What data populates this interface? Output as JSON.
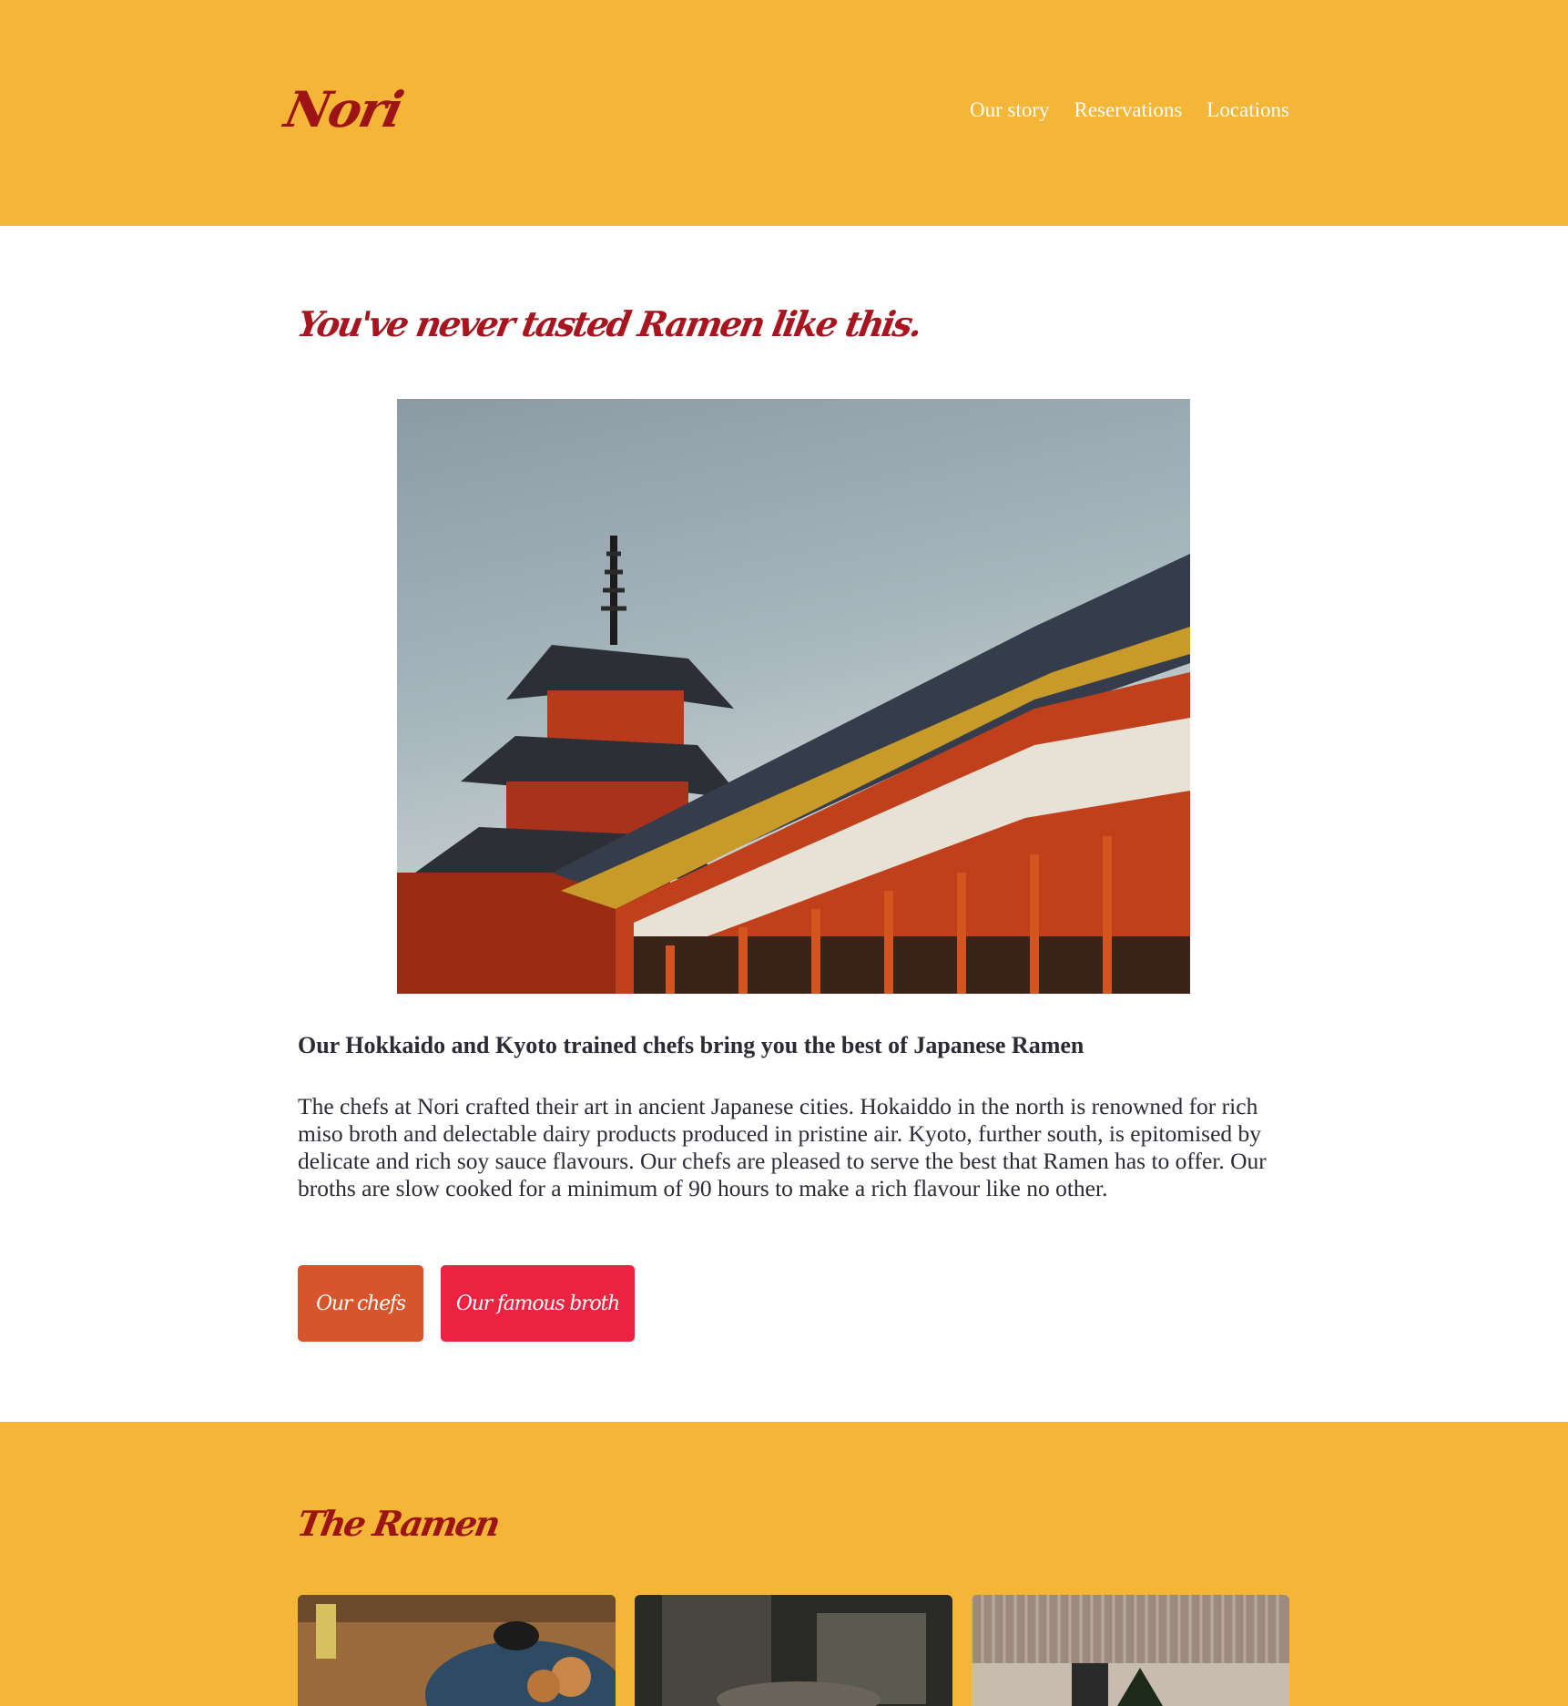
{
  "header": {
    "logo": "Nori",
    "nav": [
      "Our story",
      "Reservations",
      "Locations"
    ]
  },
  "hero": {
    "title": "You've never tasted Ramen like this.",
    "subhead": "Our Hokkaido and Kyoto trained chefs bring you the best of Japanese Ramen",
    "body": "The chefs at Nori crafted their art in ancient Japanese cities. Hokaiddo in the north is renowned for rich miso broth and delectable dairy products produced in pristine air. Kyoto, further south, is epitomised by delicate and rich soy sauce flavours. Our chefs are pleased to serve the best that Ramen has to offer. Our broths are slow cooked for a minimum of 90 hours to make a rich flavour like no other.",
    "buttons": {
      "chefs": "Our chefs",
      "broth": "Our famous broth"
    }
  },
  "ramen": {
    "title": "The Ramen"
  },
  "colors": {
    "brand_yellow": "#f5b537",
    "logo_red": "#9c1414",
    "button_orange": "#d8542c",
    "button_red": "#ec2340"
  }
}
